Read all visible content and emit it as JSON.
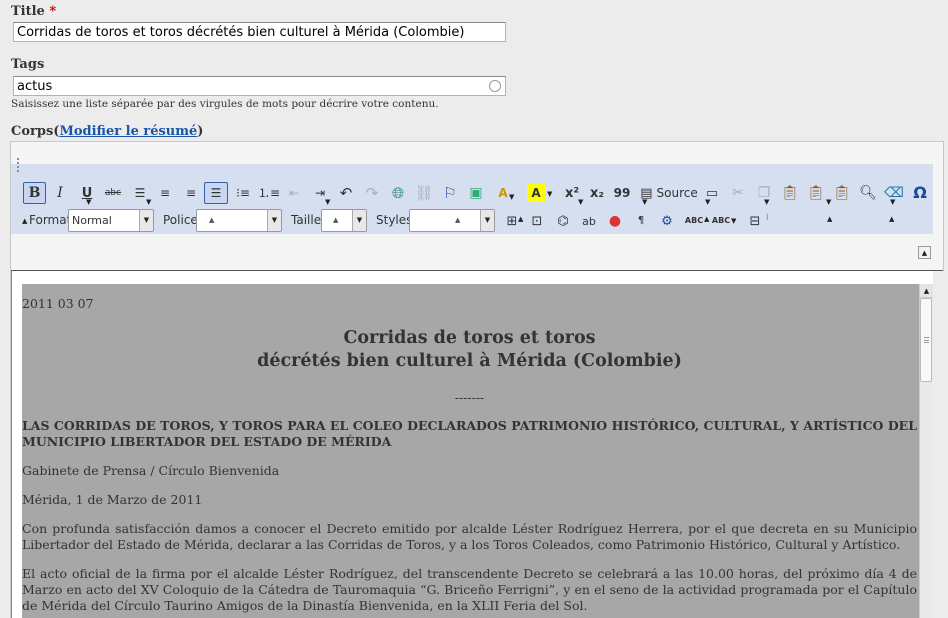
{
  "form": {
    "title_label": "Title",
    "required_mark": "*",
    "title_value": "Corridas de toros et toros décrétés bien culturel à Mérida (Colombie)",
    "tags_label": "Tags",
    "tags_value": "actus",
    "tags_description": "Saisissez une liste séparée par des virgules de mots pour décrire votre contenu.",
    "body_label": "Corps",
    "body_paren_open": "(",
    "summary_link": "Modifier le résumé",
    "body_paren_close": ")"
  },
  "toolbar": {
    "bold": "B",
    "italic": "I",
    "underline": "U",
    "strike": "abc",
    "superscript": "x²",
    "subscript": "x₂",
    "blockquote": "99",
    "source": "Source",
    "omega": "Ω",
    "format_label": "Format",
    "format_value": "Normal",
    "font_label": "Police",
    "size_label": "Taille",
    "styles_label": "Styles",
    "spell1": "ABC",
    "spell2": "ABC"
  },
  "document": {
    "date": "2011 03 07",
    "title_line1": "Corridas de toros et toros",
    "title_line2": "décrétés bien culturel à Mérida (Colombie)",
    "separator": "-------",
    "headline": "LAS CORRIDAS DE TOROS, Y TOROS PARA EL COLEO DECLARADOS PATRIMONIO HISTÓRICO, CULTURAL, Y ARTÍSTICO DEL MUNICIPIO LIBERTADOR DEL ESTADO DE MÉRIDA",
    "source": "Gabinete de Prensa / Círculo Bienvenida",
    "place_date": "Mérida, 1 de Marzo de 2011",
    "para1": "Con profunda satisfacción damos a conocer el Decreto emitido por alcalde Léster Rodríguez Herrera, por el que decreta en su Municipio Libertador del Estado de Mérida, declarar a las Corridas de Toros, y a los Toros Coleados, como Patrimonio Histórico, Cultural y Artístico.",
    "para2": "El acto oficial de la firma por el alcalde Léster Rodríguez, del transcendente Decreto se celebrará a las 10.00 horas, del próximo día 4 de Marzo en acto del XV Coloquio de la Cátedra de Tauromaquia “G. Briceño Ferrigni”, y en el seno de la actividad programada por el Capítulo de Mérida del Círculo Taurino Amigos de la Dinastía Bienvenida, en la XLII Feria del Sol."
  }
}
